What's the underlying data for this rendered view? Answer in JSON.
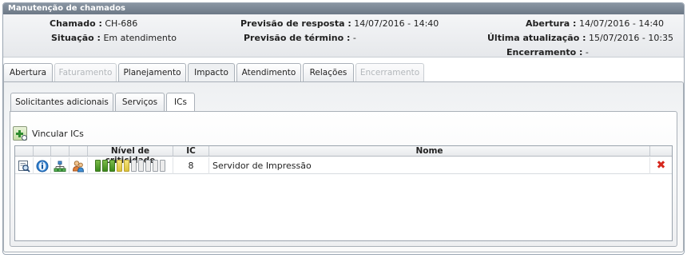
{
  "panel": {
    "title": "Manutenção de chamados"
  },
  "info": {
    "chamado_label": "Chamado :",
    "chamado": "CH-686",
    "situacao_label": "Situação :",
    "situacao": "Em atendimento",
    "previsao_resposta_label": "Previsão de resposta :",
    "previsao_resposta": "14/07/2016 - 14:40",
    "previsao_termino_label": "Previsão de término :",
    "previsao_termino": "-",
    "abertura_label": "Abertura :",
    "abertura": "14/07/2016 - 14:40",
    "ultima_atualizacao_label": "Última atualização :",
    "ultima_atualizacao": "15/07/2016 - 10:35",
    "encerramento_label": "Encerramento :",
    "encerramento": "-"
  },
  "tabs": [
    {
      "label": "Abertura",
      "state": "normal"
    },
    {
      "label": "Faturamento",
      "state": "disabled"
    },
    {
      "label": "Planejamento",
      "state": "normal"
    },
    {
      "label": "Impacto",
      "state": "active"
    },
    {
      "label": "Atendimento",
      "state": "normal"
    },
    {
      "label": "Relações",
      "state": "normal"
    },
    {
      "label": "Encerramento",
      "state": "disabled"
    }
  ],
  "subtabs": [
    {
      "label": "Solicitantes adicionais",
      "state": "normal"
    },
    {
      "label": "Serviços",
      "state": "normal"
    },
    {
      "label": "ICs",
      "state": "active"
    }
  ],
  "ics": {
    "vincular_label": "Vincular ICs",
    "columns": {
      "criticidade": "Nível de criticidade",
      "ic": "IC",
      "nome": "Nome"
    },
    "rows": [
      {
        "criticidade_level": 5,
        "criticidade_max": 10,
        "ic": "8",
        "nome": "Servidor de Impressão"
      }
    ]
  }
}
